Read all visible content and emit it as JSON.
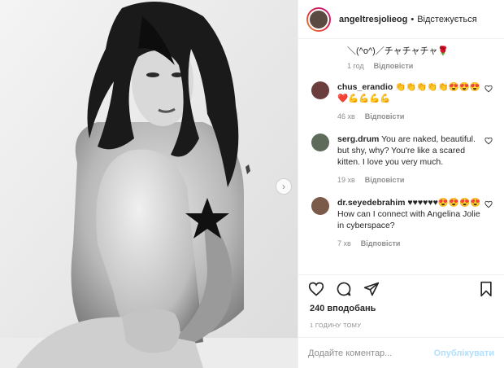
{
  "header": {
    "username": "angeltresjolieog",
    "separator": "•",
    "follow_state": "Відстежується"
  },
  "caption_tail": {
    "text": "＼(^o^)／チャチャチャ🌹",
    "time": "1 год",
    "reply": "Відповісти"
  },
  "comments": [
    {
      "username": "chus_erandio",
      "text": "👏👏👏👏👏😍😍😍❤️💪💪💪💪",
      "time": "46 хв",
      "reply": "Відповісти"
    },
    {
      "username": "serg.drum",
      "text": "You are naked, beautiful. but shy, why? You're like a scared kitten. I love you very much.",
      "time": "19 хв",
      "reply": "Відповісти"
    },
    {
      "username": "dr.seyedebrahim",
      "text": "♥♥♥♥♥♥😍😍😍😍How can I connect with Angelina Jolie in cyberspace?",
      "time": "7 хв",
      "reply": "Відповісти"
    }
  ],
  "likes": "240 вподобань",
  "timestamp": "1 ГОДИНУ ТОМУ",
  "add_comment": {
    "placeholder": "Додайте коментар...",
    "post_label": "Опублікувати"
  },
  "icons": {
    "like": "heart-icon",
    "comment": "comment-icon",
    "share": "share-icon",
    "save": "bookmark-icon",
    "next": "chevron-right-icon",
    "censor": "star-icon"
  },
  "colors": {
    "post_button": "#b2dffc",
    "secondary_text": "#8e8e8e",
    "story_ring_start": "#f09433",
    "story_ring_end": "#bc1888"
  }
}
